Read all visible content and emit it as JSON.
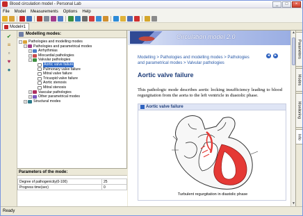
{
  "window": {
    "title": "Blood circulation model - Personal Lab",
    "controls": {
      "minimize": "_",
      "maximize": "□",
      "close": "×"
    }
  },
  "menu": {
    "items": [
      "File",
      "Model",
      "Measurements",
      "Options",
      "Help"
    ]
  },
  "doc_tab": {
    "label": "Model#1"
  },
  "modes_panel": {
    "title": "Modelling modes:",
    "tree": [
      {
        "label": "Pathologies and modelling modes",
        "level": 0,
        "expanded": true
      },
      {
        "label": "Pathologies and parametrical modes",
        "level": 1,
        "expanded": true
      },
      {
        "label": "Arrhythmias",
        "level": 2,
        "expanded": false
      },
      {
        "label": "Miocardial pathologies",
        "level": 2,
        "expanded": false
      },
      {
        "label": "Valvular pathologies",
        "level": 2,
        "expanded": true
      },
      {
        "label": "Aortic valve failure",
        "level": 3,
        "selected": true
      },
      {
        "label": "Pulmonary valve failure",
        "level": 3
      },
      {
        "label": "Mitral valve failure",
        "level": 3
      },
      {
        "label": "Tricuspid valve failure",
        "level": 3
      },
      {
        "label": "Aortic stenosis",
        "level": 3
      },
      {
        "label": "Mitral stenosis",
        "level": 3
      },
      {
        "label": "Vascular pathologies",
        "level": 2,
        "expanded": false
      },
      {
        "label": "Other parametrical modes",
        "level": 2,
        "expanded": false
      },
      {
        "label": "Structural modes",
        "level": 1,
        "expanded": false
      }
    ]
  },
  "params_panel": {
    "title": "Parameters of the mode:",
    "rows": [
      {
        "name": "Degree of pathogenicity(0-100)",
        "value": "25"
      },
      {
        "name": "Progress time(sec)",
        "value": "0"
      }
    ]
  },
  "content": {
    "banner_title": "Circulation model 2.0",
    "breadcrumb": "Modelling > Pathologies and modelling modes > Pathologies and parametrical modes > Valvular pathologies",
    "nav_prev": "◄",
    "nav_next": "►",
    "heading": "Aortic valve failure",
    "description": "This pathologic mode describes aortic locking insufficiency leading to blood regurgitation from the aorta to the left ventricle in diastolic phase.",
    "figure_title": "Aortic valve failure",
    "figure_caption": "Turbulent regurgitation in diastolic phase"
  },
  "right_tabs": [
    "Parameters",
    "Modes",
    "Monitoring",
    "Info"
  ],
  "statusbar": {
    "text": "Ready"
  },
  "colors": {
    "accent": "#316ac5",
    "regurgitation": "#e53935"
  }
}
